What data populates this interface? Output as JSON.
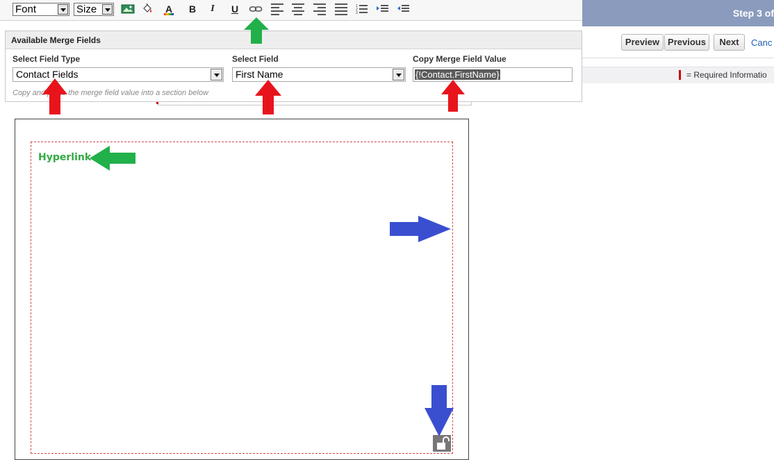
{
  "toolbar": {
    "font_label": "Font",
    "size_label": "Size",
    "bold": "B",
    "italic": "I",
    "underline": "U",
    "text_color": "A"
  },
  "wizard": {
    "step": "Step 3 of",
    "buttons": {
      "preview": "Preview",
      "previous": "Previous",
      "next": "Next",
      "cancel": "Canc"
    },
    "required_legend": "= Required Informatio"
  },
  "merge_fields": {
    "title": "Available Merge Fields",
    "field_type_label": "Select Field Type",
    "field_type_value": "Contact Fields",
    "field_label": "Select Field",
    "field_value": "First Name",
    "copy_label": "Copy Merge Field Value",
    "copy_value": "{!Contact.FirstName}",
    "hint": "Copy and paste the merge field value into a section below"
  },
  "editor": {
    "hyperlink_text": "Hyperlink"
  },
  "colors": {
    "annotation_red": "#e8141c",
    "annotation_green": "#22b04a",
    "annotation_blue": "#3a4fd0",
    "step_bar": "#8b9bbd"
  }
}
